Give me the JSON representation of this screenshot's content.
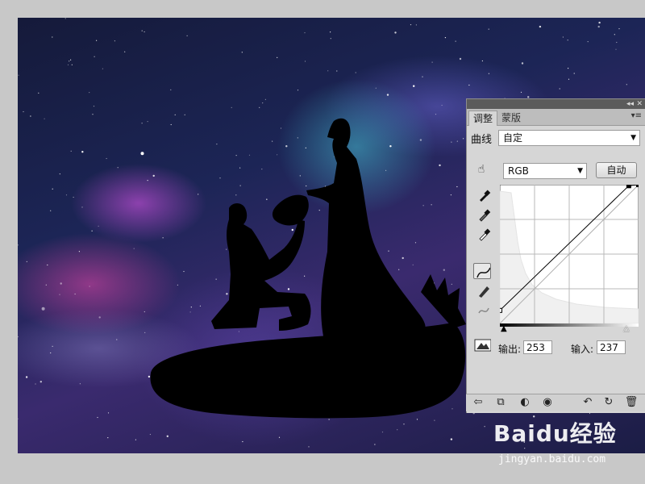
{
  "panel": {
    "tabs": [
      {
        "label": "调整",
        "active": true
      },
      {
        "label": "蒙版",
        "active": false
      }
    ],
    "curves_label": "曲线",
    "preset_value": "自定",
    "channel_value": "RGB",
    "auto_button": "自动",
    "output_label": "输出:",
    "output_value": "253",
    "input_label": "输入:",
    "input_value": "237",
    "titlebar_icons": [
      "collapse-icon",
      "close-icon"
    ],
    "tool_icons": [
      "hand-adjust-icon",
      "black-eyedropper-icon",
      "gray-eyedropper-icon",
      "white-eyedropper-icon",
      "curve-point-icon",
      "pencil-draw-icon",
      "smooth-curve-icon",
      "clipping-warning-icon"
    ],
    "bottom_icons": [
      "back-arrow-icon",
      "clip-layer-icon",
      "mask-icon",
      "visibility-eye-icon",
      "reset-previous-icon",
      "reset-default-icon",
      "trash-icon"
    ]
  },
  "curve": {
    "points": [
      {
        "input": 0,
        "output": 24
      },
      {
        "input": 237,
        "output": 253
      },
      {
        "input": 255,
        "output": 255
      }
    ]
  },
  "watermark": {
    "logo": "Baidu经验",
    "url": "jingyan.baidu.com"
  },
  "colors": {
    "panel_bg": "#d6d6d6",
    "titlebar": "#5b5b5b",
    "histogram": "#f2f2f2",
    "curve_line": "#000000"
  }
}
